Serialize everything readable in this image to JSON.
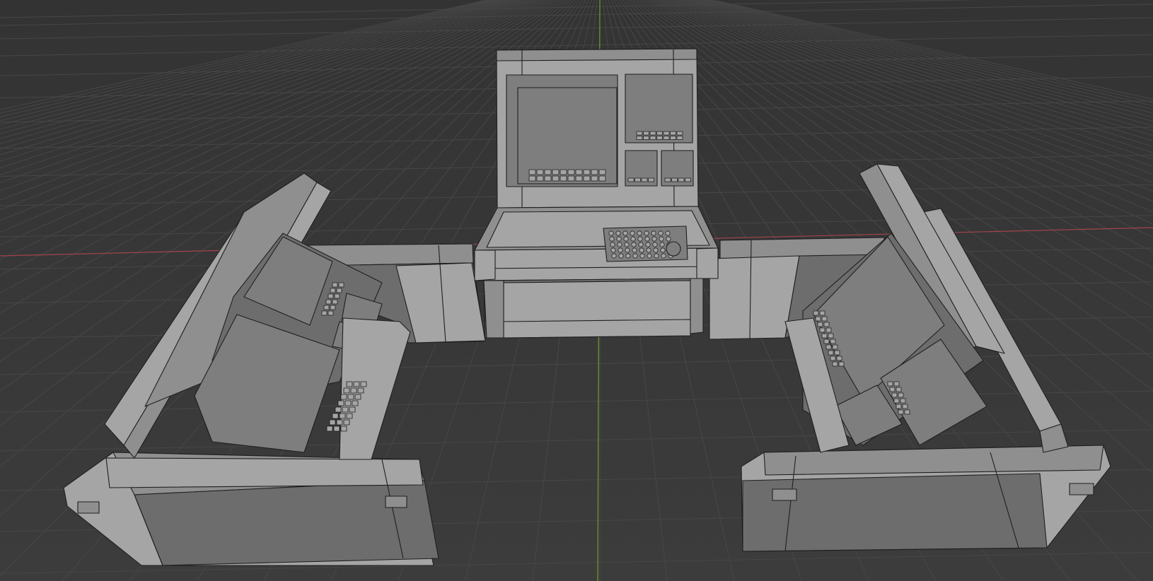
{
  "viewport": {
    "background": "#3a3a3a",
    "grid_color": "#474747",
    "x_axis_color": "#a2444b",
    "y_axis_color": "#6f9a2a",
    "mesh_light": "#a5a5a5",
    "mesh_mid": "#8f8f8f",
    "mesh_dark": "#6d6d6d",
    "mesh_screen": "#7e7e7e",
    "wire_color": "#1f1f1f"
  },
  "scene": {
    "objects": [
      "center-console",
      "left-console",
      "right-console",
      "left-connector-wall",
      "right-connector-wall"
    ]
  }
}
